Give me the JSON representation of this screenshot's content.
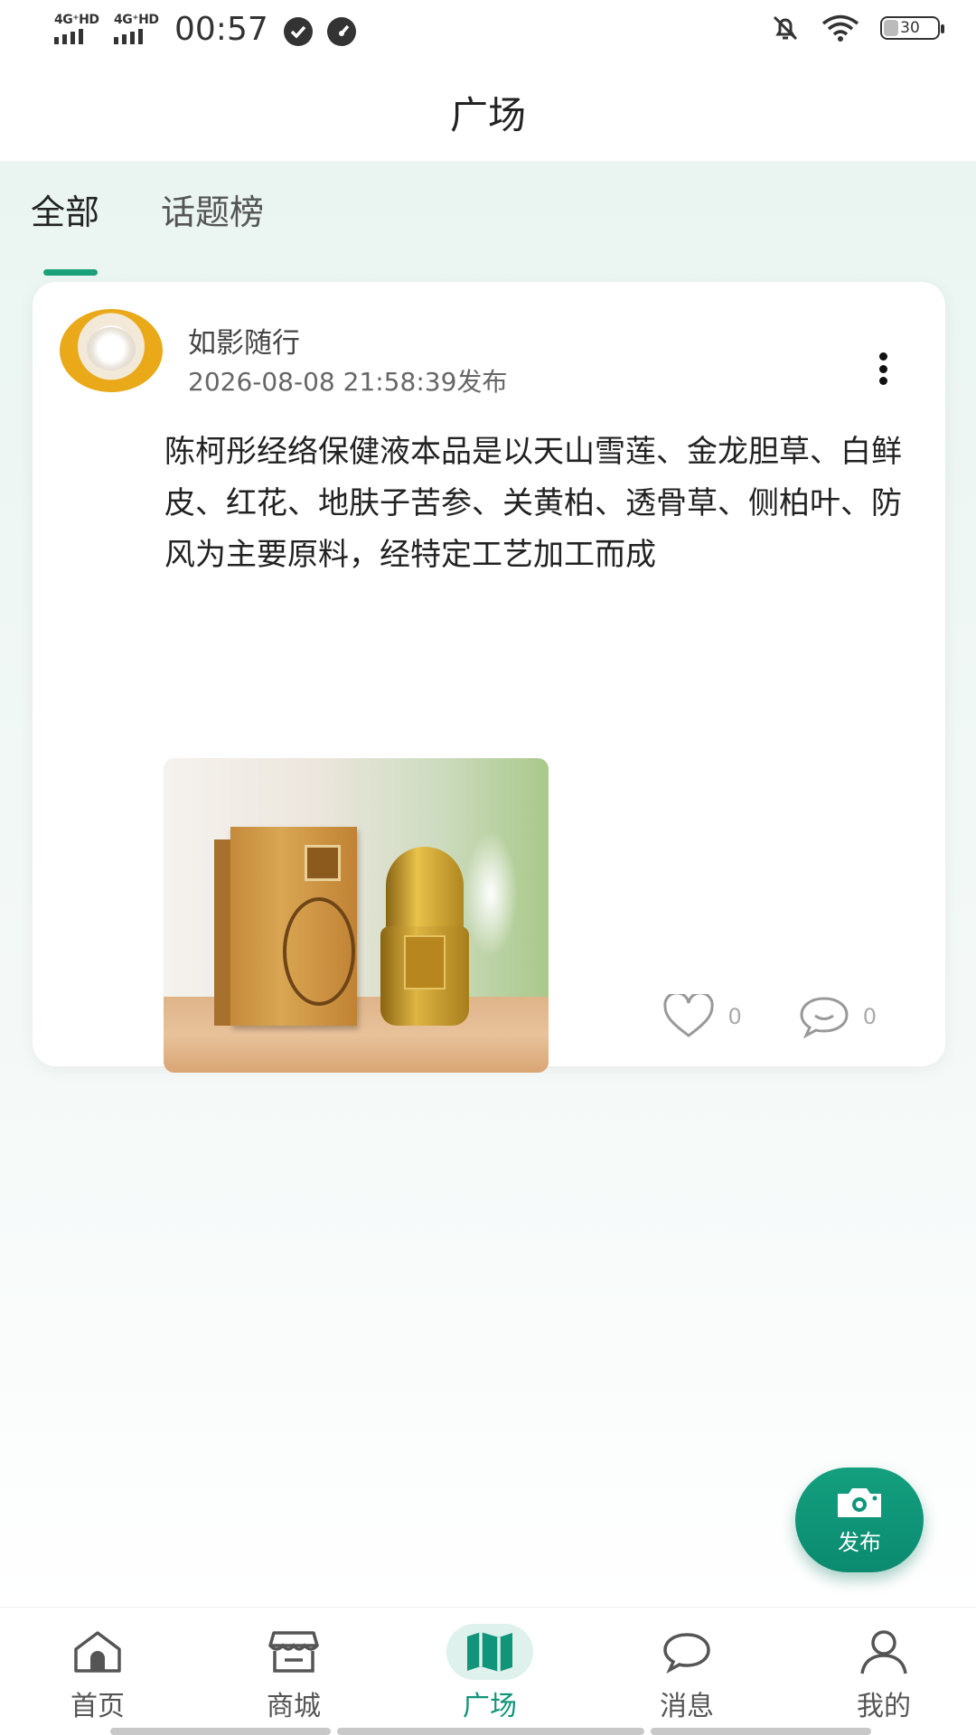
{
  "status_bar": {
    "sim1_label": "4G⁺HD",
    "sim2_label": "4G⁺HD",
    "time": "00:57",
    "battery": "30",
    "icons": [
      "check-circle-icon",
      "speedometer-icon",
      "bell-off-icon",
      "wifi-icon",
      "battery-icon"
    ]
  },
  "header": {
    "title": "广场"
  },
  "tabs": [
    {
      "label": "全部",
      "active": true
    },
    {
      "label": "话题榜",
      "active": false
    }
  ],
  "post": {
    "username": "如影随行",
    "time": "2026-08-08 21:58:39发布",
    "text": "陈柯彤经络保健液本品是以天山雪莲、金龙胆草、白鲜皮、红花、地肤子苦参、关黄柏、透骨草、侧柏叶、防风为主要原料，经特定工艺加工而成",
    "likes": "0",
    "comments": "0"
  },
  "fab": {
    "label": "发布",
    "icon": "camera-icon"
  },
  "bottom_nav": [
    {
      "label": "首页",
      "icon": "home-icon",
      "active": false
    },
    {
      "label": "商城",
      "icon": "store-icon",
      "active": false
    },
    {
      "label": "广场",
      "icon": "map-icon",
      "active": true
    },
    {
      "label": "消息",
      "icon": "chat-bubble-icon",
      "active": false
    },
    {
      "label": "我的",
      "icon": "user-icon",
      "active": false
    }
  ],
  "colors": {
    "accent": "#1aa17a",
    "fab": "#0f957a",
    "active_nav_bg": "#dff1ec"
  }
}
